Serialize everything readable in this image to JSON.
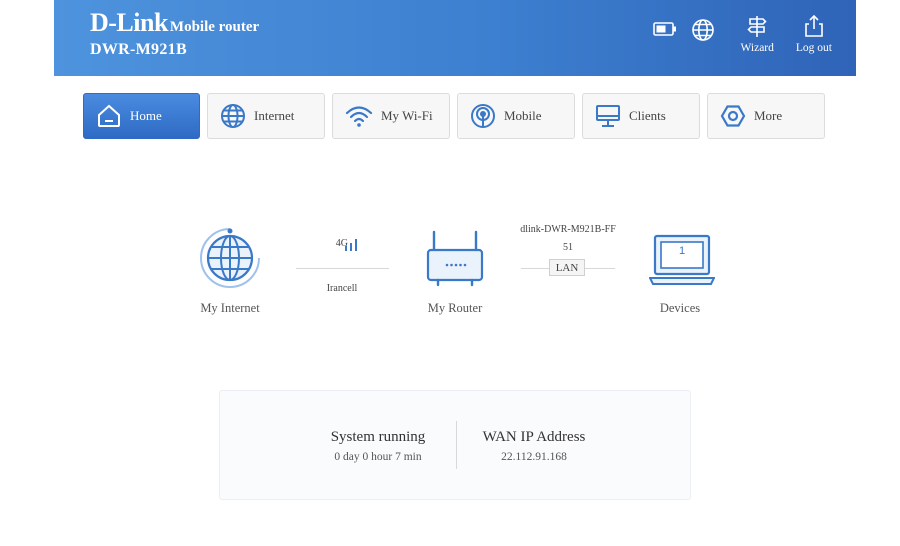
{
  "header": {
    "brand": "D-Link",
    "subtitle": "Mobile router",
    "model": "DWR-M921B",
    "wizard_label": "Wizard",
    "logout_label": "Log out"
  },
  "nav": [
    {
      "label": "Home",
      "icon": "home-icon",
      "active": true
    },
    {
      "label": "Internet",
      "icon": "globe-icon",
      "active": false
    },
    {
      "label": "My Wi-Fi",
      "icon": "wifi-icon",
      "active": false
    },
    {
      "label": "Mobile",
      "icon": "antenna-icon",
      "active": false
    },
    {
      "label": "Clients",
      "icon": "monitor-icon",
      "active": false
    },
    {
      "label": "More",
      "icon": "hexagon-icon",
      "active": false
    }
  ],
  "topology": {
    "internet_label": "My Internet",
    "network_type": "4G",
    "carrier": "Irancell",
    "router_label": "My Router",
    "ssid": "dlink-DWR-M921B-FF",
    "ssid_suffix": "51",
    "lan_label": "LAN",
    "devices_label": "Devices",
    "devices_count": "1"
  },
  "status": {
    "uptime_title": "System running",
    "uptime_value": "0 day 0 hour 7 min",
    "wan_title": "WAN IP Address",
    "wan_value": "22.112.91.168"
  },
  "colors": {
    "accent": "#3d7fd0",
    "icon_blue": "#3a78c8",
    "header_start": "#4e93dd",
    "header_end": "#2f64b8"
  }
}
